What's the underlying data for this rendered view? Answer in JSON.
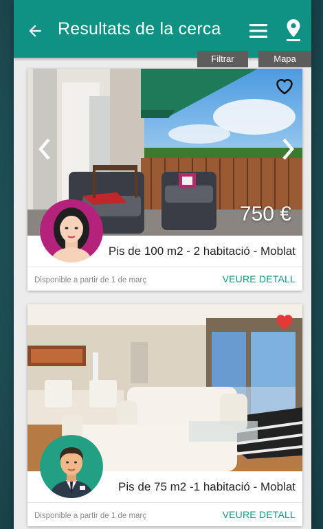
{
  "appbar": {
    "title": "Resultats de la cerca",
    "back_icon": "arrow-left-icon",
    "filter_icon": "menu-icon",
    "map_icon": "map-pin-icon",
    "color": "#0f9183"
  },
  "tooltips": {
    "filter": "Filtrar",
    "map": "Mapa"
  },
  "listings": [
    {
      "price": "750 €",
      "title": "Pis de 100 m2 - 2 habitació - Moblat",
      "availability": "Disponible a partir de 1 de març",
      "detail_label": "VEURE DETALL",
      "favorite": false,
      "has_price": true,
      "agent": "female-avatar"
    },
    {
      "price": "",
      "title": "Pis de 75 m2 -1 habitació - Moblat",
      "availability": "Disponible a partir de 1 de març",
      "detail_label": "VEURE DETALL",
      "favorite": true,
      "has_price": false,
      "agent": "male-avatar"
    }
  ],
  "colors": {
    "accent": "#0f9183",
    "link": "#139886",
    "favorite": "#e53935"
  }
}
